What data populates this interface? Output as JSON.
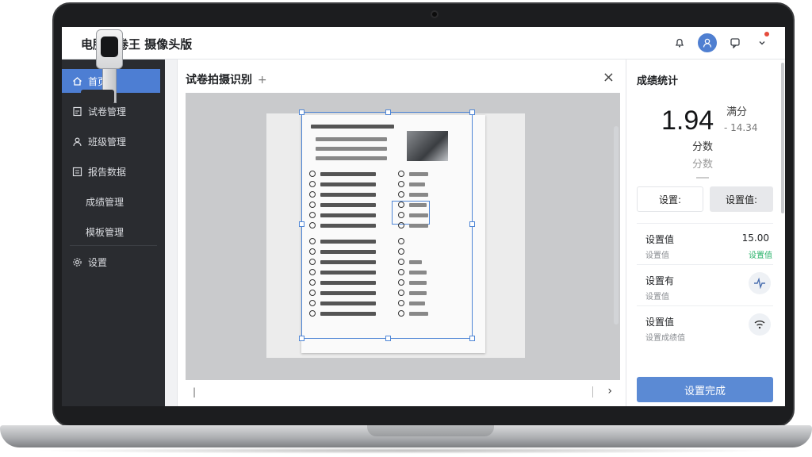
{
  "app": {
    "title": "电脑阅卷王 摄像头版"
  },
  "topbar": {
    "icons": [
      "bell-icon",
      "user-avatar-icon",
      "notification-icon",
      "chevron-down-icon"
    ]
  },
  "sidebar": {
    "items": [
      {
        "label": "首页",
        "icon": "home-icon",
        "active": true
      },
      {
        "label": "试卷管理",
        "icon": "document-edit-icon"
      },
      {
        "label": "班级管理",
        "icon": "user-icon"
      },
      {
        "label": "报告数据",
        "icon": "list-icon"
      },
      {
        "label": "成绩管理",
        "icon": ""
      },
      {
        "label": "模板管理",
        "icon": ""
      },
      {
        "label": "设置",
        "icon": "gear-icon"
      }
    ]
  },
  "center": {
    "title": "试卷拍摄识别",
    "plus": "+",
    "close": "×",
    "page_left": "|",
    "page_next": "›"
  },
  "right": {
    "title": "成绩统计",
    "score": "1.94",
    "score_sub1": "满分",
    "score_sub2": "- 14.34",
    "label1": "分数",
    "label2": "分数",
    "btn_a": "设置:",
    "btn_b": "设置值:",
    "items": [
      {
        "title": "设置值",
        "sub": "设置值",
        "value": "15.00",
        "value2": "设置值"
      },
      {
        "title": "设置有",
        "sub": "设置值",
        "icon": "pulse-icon"
      },
      {
        "title": "设置值",
        "sub": "设置成绩值",
        "icon": "wifi-icon"
      }
    ],
    "primary": "设置完成"
  },
  "colors": {
    "accent": "#4d7ed3",
    "sidebar_bg": "#2a2c30",
    "primary_button": "#5b8ad4",
    "success": "#2bb36b"
  }
}
